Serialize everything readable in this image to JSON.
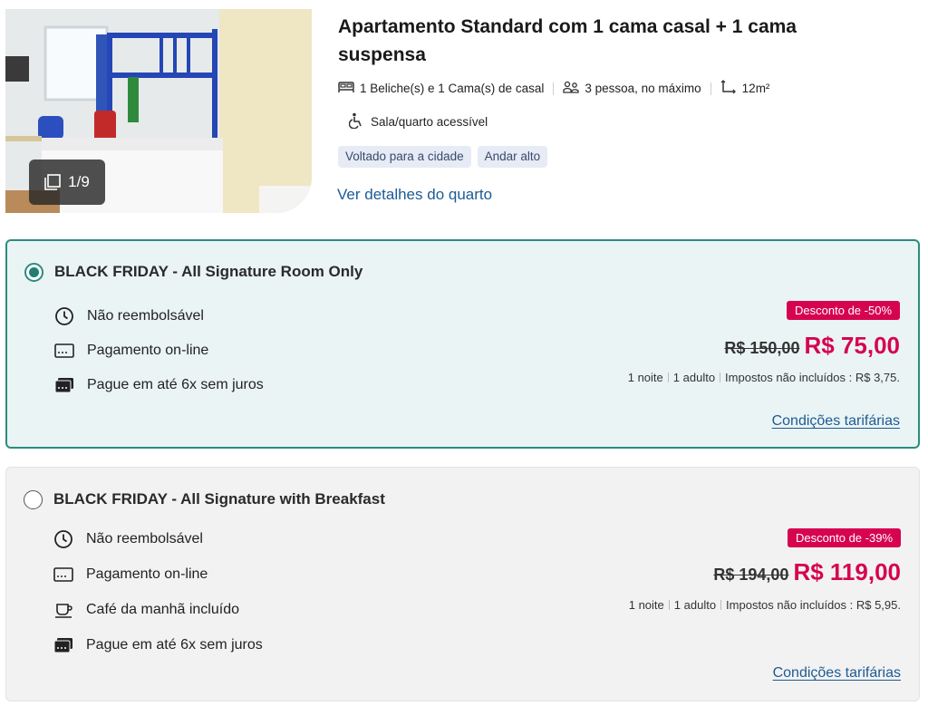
{
  "room": {
    "photo_counter": "1/9",
    "title": "Apartamento Standard com 1 cama casal + 1 cama suspensa",
    "features": {
      "beds": "1 Beliche(s) e 1 Cama(s) de casal",
      "capacity": "3 pessoa, no máximo",
      "area": "12m²",
      "accessibility": "Sala/quarto acessível"
    },
    "tags": [
      "Voltado para a cidade",
      "Andar alto"
    ],
    "details_link": "Ver detalhes do quarto"
  },
  "rates": [
    {
      "name": "BLACK FRIDAY - All Signature Room Only",
      "selected": true,
      "conditions": [
        "Não reembolsável",
        "Pagamento on-line",
        "Pague em até 6x sem juros"
      ],
      "discount": "Desconto de -50%",
      "old_price": "R$ 150,00",
      "new_price": "R$ 75,00",
      "nights": "1 noite",
      "adults": "1 adulto",
      "taxes": "Impostos não incluídos : R$ 3,75.",
      "conditions_link": "Condições tarifárias"
    },
    {
      "name": "BLACK FRIDAY - All Signature with Breakfast",
      "selected": false,
      "conditions": [
        "Não reembolsável",
        "Pagamento on-line",
        "Café da manhã incluído",
        "Pague em até 6x sem juros"
      ],
      "discount": "Desconto de -39%",
      "old_price": "R$ 194,00",
      "new_price": "R$ 119,00",
      "nights": "1 noite",
      "adults": "1 adulto",
      "taxes": "Impostos não incluídos : R$ 5,95.",
      "conditions_link": "Condições tarifárias"
    }
  ],
  "colors": {
    "accent_teal": "#2b8c80",
    "price_pink": "#d6044f",
    "link_blue": "#1d5b94"
  }
}
